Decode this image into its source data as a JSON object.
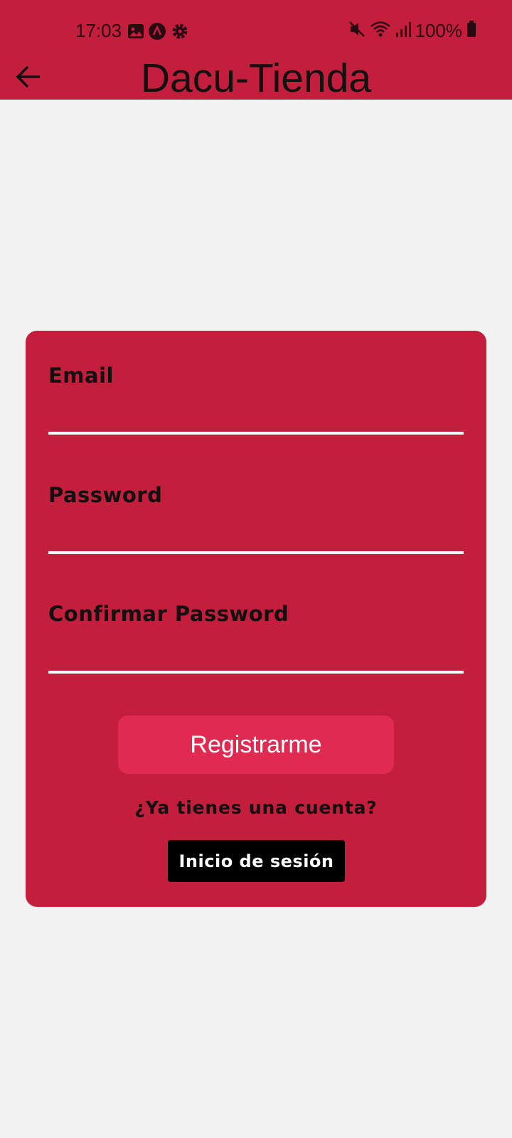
{
  "status_bar": {
    "time": "17:03",
    "battery": "100%",
    "left_icons": [
      "gallery-icon",
      "app-a-icon",
      "gear-icon"
    ],
    "right_icons": [
      "mute-icon",
      "wifi-icon",
      "signal-icon",
      "battery-icon"
    ]
  },
  "app_bar": {
    "title": "Dacu-Tienda",
    "back_icon": "arrow-left-icon",
    "color": "#c41e3d"
  },
  "form": {
    "email_label": "Email",
    "email_value": "",
    "password_label": "Password",
    "password_value": "",
    "confirm_label": "Confirmar Password",
    "confirm_value": "",
    "submit_label": "Registrarme",
    "question": "¿Ya tienes una cuenta?",
    "login_label": "Inicio de sesión",
    "card_color": "#c41e3d",
    "submit_color": "#e12a52"
  }
}
